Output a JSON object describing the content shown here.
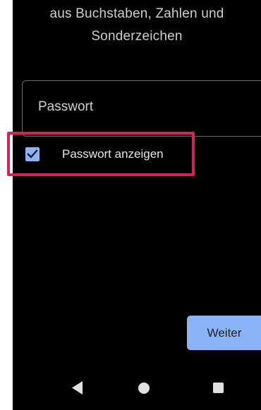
{
  "hint": {
    "line1": "aus Buchstaben, Zahlen und",
    "line2": "Sonderzeichen"
  },
  "password_field": {
    "placeholder": "Passwort",
    "value": ""
  },
  "show_password": {
    "label": "Passwort anzeigen",
    "checked": true
  },
  "buttons": {
    "next_label": "Weiter"
  },
  "navbar": {
    "back_icon": "triangle-back-icon",
    "home_icon": "circle-home-icon",
    "recents_icon": "square-recents-icon"
  },
  "colors": {
    "accent": "#8ab4f8",
    "background": "#000000",
    "highlight": "#d6225c"
  }
}
